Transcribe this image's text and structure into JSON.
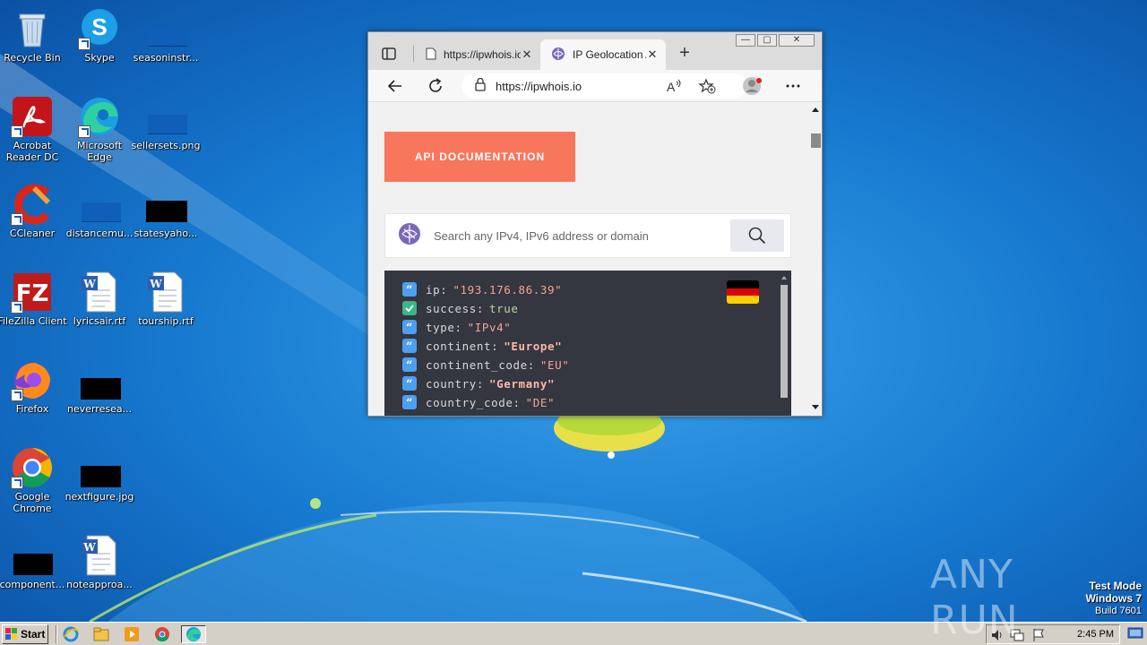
{
  "desktop": {
    "icons": [
      {
        "label": "Recycle Bin",
        "icon": "recycle-bin-icon"
      },
      {
        "label": "Skype",
        "icon": "skype-icon"
      },
      {
        "label": "seasoninstr...",
        "icon": "file-icon"
      },
      {
        "label": "Acrobat Reader DC",
        "icon": "acrobat-icon"
      },
      {
        "label": "Microsoft Edge",
        "icon": "edge-icon"
      },
      {
        "label": "sellersets.png",
        "icon": "image-file-icon"
      },
      {
        "label": "CCleaner",
        "icon": "ccleaner-icon"
      },
      {
        "label": "distancemu...",
        "icon": "file-icon"
      },
      {
        "label": "statesyaho...",
        "icon": "file-icon"
      },
      {
        "label": "FileZilla Client",
        "icon": "filezilla-icon"
      },
      {
        "label": "lyricsair.rtf",
        "icon": "word-doc-icon"
      },
      {
        "label": "tourship.rtf",
        "icon": "word-doc-icon"
      },
      {
        "label": "Firefox",
        "icon": "firefox-icon"
      },
      {
        "label": "neverresea...",
        "icon": "file-icon"
      },
      {
        "label": "Google Chrome",
        "icon": "chrome-icon"
      },
      {
        "label": "nextfigure.jpg",
        "icon": "image-file-icon"
      },
      {
        "label": "component...",
        "icon": "file-icon"
      },
      {
        "label": "noteapproa...",
        "icon": "word-doc-icon"
      }
    ]
  },
  "browser": {
    "tabs": [
      {
        "title": "https://ipwhois.io",
        "close": "✕"
      },
      {
        "title": "IP Geolocation API",
        "close": "✕"
      }
    ],
    "new_tab": "+",
    "url": "https://ipwhois.io",
    "window_buttons": {
      "minimize": "—",
      "maximize": "▢",
      "close": "✕"
    }
  },
  "page": {
    "api_button": "API DOCUMENTATION",
    "search_placeholder": "Search any IPv4, IPv6 address or domain",
    "json": [
      {
        "key": "ip",
        "value": "\"193.176.86.39\"",
        "type": "str",
        "bold": false
      },
      {
        "key": "success",
        "value": "true",
        "type": "bool",
        "bold": false
      },
      {
        "key": "type",
        "value": "\"IPv4\"",
        "type": "str",
        "bold": false
      },
      {
        "key": "continent",
        "value": "\"Europe\"",
        "type": "str",
        "bold": true
      },
      {
        "key": "continent_code",
        "value": "\"EU\"",
        "type": "str",
        "bold": false
      },
      {
        "key": "country",
        "value": "\"Germany\"",
        "type": "str",
        "bold": true
      },
      {
        "key": "country_code",
        "value": "\"DE\"",
        "type": "str",
        "bold": false
      }
    ],
    "flag_colors": [
      "#000000",
      "#dd0000",
      "#ffce00"
    ]
  },
  "taskbar": {
    "start": "Start",
    "clock": "2:45 PM"
  },
  "watermark": {
    "brand": "ANY RUN",
    "line1": "Test Mode",
    "line2": "Windows 7",
    "line3": "Build 7601"
  }
}
